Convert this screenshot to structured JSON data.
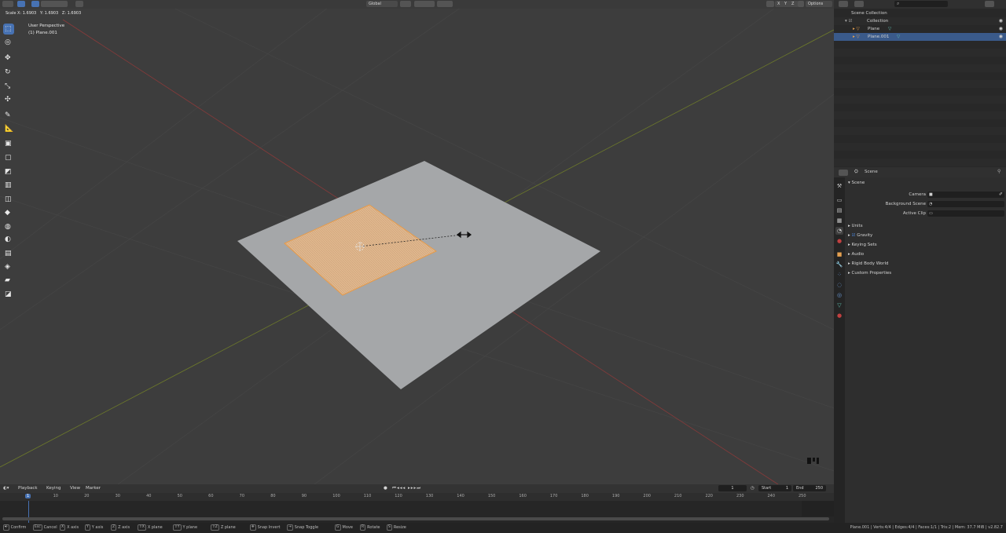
{
  "viewport": {
    "scale_readout": "Scale X: 1.6903   Y: 1.6903   Z: 1.6903",
    "view_name": "User Perspective",
    "object_name": "(1) Plane.001",
    "header": {
      "orientation": "Global",
      "axes": [
        "X",
        "Y",
        "Z"
      ],
      "options": "Options"
    }
  },
  "toolbar": {
    "tools": [
      {
        "name": "select-box-tool",
        "glyph": "⬚"
      },
      {
        "name": "cursor-tool",
        "glyph": "◎"
      },
      {
        "name": "move-tool",
        "glyph": "✥"
      },
      {
        "name": "rotate-tool",
        "glyph": "↻"
      },
      {
        "name": "scale-tool",
        "glyph": "⤡"
      },
      {
        "name": "transform-tool",
        "glyph": "✣"
      },
      {
        "name": "annotate-tool",
        "glyph": "✎"
      },
      {
        "name": "measure-tool",
        "glyph": "📐"
      },
      {
        "name": "extrude-tool",
        "glyph": "▣"
      },
      {
        "name": "inset-tool",
        "glyph": "▢"
      },
      {
        "name": "bevel-tool",
        "glyph": "◩"
      },
      {
        "name": "loop-cut-tool",
        "glyph": "▥"
      },
      {
        "name": "knife-tool",
        "glyph": "◫"
      },
      {
        "name": "poly-build-tool",
        "glyph": "◆"
      },
      {
        "name": "spin-tool",
        "glyph": "◍"
      },
      {
        "name": "smooth-tool",
        "glyph": "◐"
      },
      {
        "name": "edge-slide-tool",
        "glyph": "▤"
      },
      {
        "name": "shrink-fatten-tool",
        "glyph": "◈"
      },
      {
        "name": "shear-tool",
        "glyph": "▰"
      },
      {
        "name": "rip-tool",
        "glyph": "◪"
      }
    ]
  },
  "outliner": {
    "search_icon": "search-icon",
    "rows": [
      {
        "label": "Scene Collection",
        "indent": 0
      },
      {
        "label": "Collection",
        "indent": 1
      },
      {
        "label": "Plane",
        "indent": 2
      },
      {
        "label": "Plane.001",
        "indent": 2
      }
    ]
  },
  "properties": {
    "context": "Scene",
    "panel_title": "Scene",
    "fields": [
      {
        "label": "Camera"
      },
      {
        "label": "Background Scene"
      },
      {
        "label": "Active Clip"
      }
    ],
    "sections": [
      "Units",
      "Gravity",
      "Keying Sets",
      "Audio",
      "Rigid Body World",
      "Custom Properties"
    ]
  },
  "timeline": {
    "menus": [
      "Playback",
      "Keying",
      "View",
      "Marker"
    ],
    "current_frame": "1",
    "start_label": "Start",
    "start": "1",
    "end_label": "End",
    "end": "250",
    "ticks": [
      "1",
      "10",
      "20",
      "30",
      "40",
      "50",
      "60",
      "70",
      "80",
      "90",
      "100",
      "110",
      "120",
      "130",
      "140",
      "150",
      "160",
      "170",
      "180",
      "190",
      "200",
      "210",
      "220",
      "230",
      "240",
      "250"
    ],
    "playhead_label": "1"
  },
  "statusbar": {
    "items": [
      {
        "key": "⎆",
        "label": "Confirm"
      },
      {
        "key": "Esc",
        "label": "Cancel"
      },
      {
        "key": "X",
        "label": "X axis"
      },
      {
        "key": "Y",
        "label": "Y axis"
      },
      {
        "key": "Z",
        "label": "Z axis"
      },
      {
        "key": "⇧X",
        "label": "X plane"
      },
      {
        "key": "⇧Y",
        "label": "Y plane"
      },
      {
        "key": "⇧Z",
        "label": "Z plane"
      },
      {
        "key": "⎈",
        "label": "Snap Invert"
      },
      {
        "key": "⇥",
        "label": "Snap Toggle"
      },
      {
        "key": "G",
        "label": "Move"
      },
      {
        "key": "R",
        "label": "Rotate"
      },
      {
        "key": "S",
        "label": "Resize"
      }
    ],
    "stats": "Plane.001 | Verts:4/4 | Edges:4/4 | Faces:1/1 | Tris:2 | Mem: 37.7 MiB | v2.82.7"
  }
}
